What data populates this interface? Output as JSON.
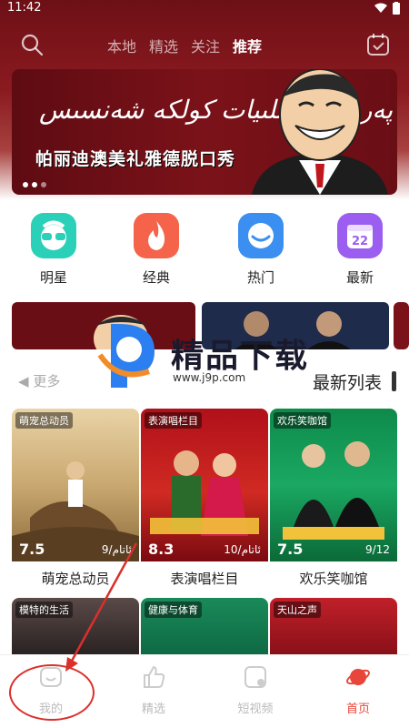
{
  "status": {
    "time": "11:42"
  },
  "nav": {
    "tabs": [
      "本地",
      "精选",
      "关注",
      "推荐"
    ],
    "active_tab": "推荐"
  },
  "banner": {
    "script_text": "پەرىدە ئومىلىيات كولكە شەنسىس",
    "title": "帕丽迪澳美礼雅德脱口秀"
  },
  "categories": [
    {
      "label": "明星",
      "icon": "sunglasses-face-icon",
      "color": "#2bd0b8"
    },
    {
      "label": "经典",
      "icon": "flame-icon",
      "color": "#f4634a"
    },
    {
      "label": "热门",
      "icon": "eye-icon",
      "color": "#3b8ff0"
    },
    {
      "label": "最新",
      "icon": "calendar-icon",
      "color": "#9c5ef0",
      "badge": "22"
    }
  ],
  "watermark": {
    "text": "精品下载",
    "url": "www.j9p.com"
  },
  "section": {
    "more": "更多",
    "title": "最新列表"
  },
  "cards": [
    {
      "tag": "萌宠总动员",
      "score": "7.5",
      "episode": "9/ئاتام",
      "title": "萌宠总动员"
    },
    {
      "tag": "表演唱栏目",
      "score": "8.3",
      "episode": "10/ئاتام",
      "title": "表演唱栏目"
    },
    {
      "tag": "欢乐笑咖馆",
      "score": "7.5",
      "episode": "9/12",
      "title": "欢乐笑咖馆"
    }
  ],
  "row2": [
    {
      "tag": "模特的生活"
    },
    {
      "tag": "健康与体育"
    },
    {
      "tag": "天山之声"
    }
  ],
  "tabbar": [
    {
      "label": "我的",
      "icon": "profile-icon"
    },
    {
      "label": "精选",
      "icon": "thumbs-up-icon"
    },
    {
      "label": "短视频",
      "icon": "short-video-icon"
    },
    {
      "label": "首页",
      "icon": "home-planet-icon",
      "active": true
    }
  ],
  "colors": {
    "accent": "#e8463a",
    "header": "#7b1219",
    "annotation": "#d9302a"
  }
}
